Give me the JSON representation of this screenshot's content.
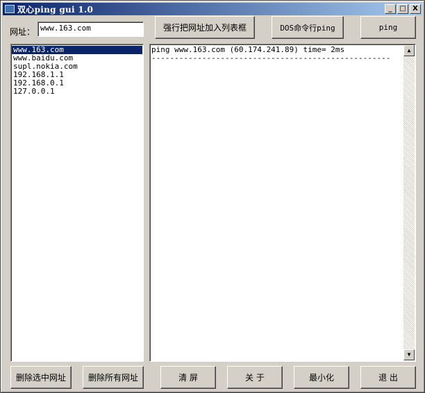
{
  "window": {
    "title": "双心ping gui 1.0",
    "controls": {
      "minimize": "_",
      "maximize": "□",
      "close": "X"
    }
  },
  "toolbar": {
    "url_label": "网址：",
    "url_value": "www.163.com",
    "add_button": "强行把网址加入列表框",
    "dos_button": "DOS命令行ping",
    "ping_button": "ping"
  },
  "url_list": {
    "items": [
      "www.163.com",
      "www.baidu.com",
      "supl.nokia.com",
      "192.168.1.1",
      "192.168.0.1",
      "127.0.0.1"
    ],
    "selected_index": 0
  },
  "output": {
    "lines": [
      "ping www.163.com (60.174.241.89) time= 2ms",
      "----------------------------------------------------"
    ]
  },
  "footer": {
    "delete_selected": "删除选中网址",
    "delete_all": "删除所有网址",
    "clear": "清 屏",
    "about": "关 于",
    "minimize": "最小化",
    "exit": "退 出"
  },
  "icons": {
    "app": "app-icon",
    "scroll_up": "▲",
    "scroll_down": "▼"
  },
  "colors": {
    "title_bar": "#0a246a",
    "selection": "#0a246a",
    "face": "#d4d0c8"
  }
}
